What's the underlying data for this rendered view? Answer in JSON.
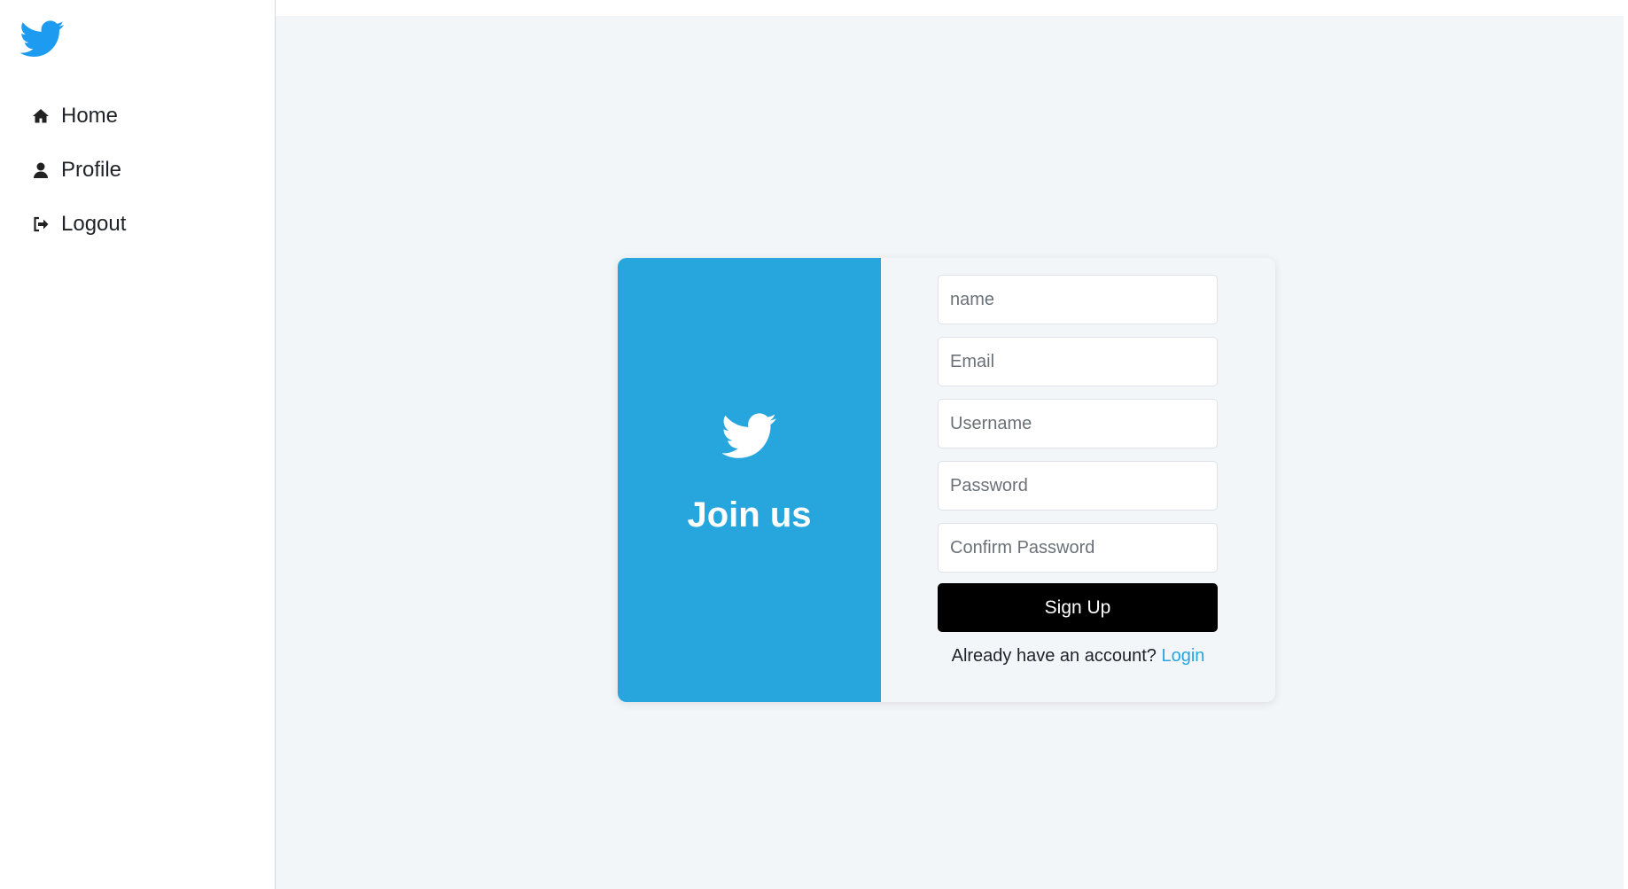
{
  "app": {
    "logo_icon": "twitter-bird-icon",
    "brand_color": "#27a6de"
  },
  "sidebar": {
    "items": [
      {
        "label": "Home",
        "icon": "home-icon"
      },
      {
        "label": "Profile",
        "icon": "user-icon"
      },
      {
        "label": "Logout",
        "icon": "logout-icon"
      }
    ]
  },
  "signup_card": {
    "panel_icon": "twitter-bird-icon",
    "heading": "Join us",
    "fields": {
      "name_placeholder": "name",
      "email_placeholder": "Email",
      "username_placeholder": "Username",
      "password_placeholder": "Password",
      "confirm_password_placeholder": "Confirm Password"
    },
    "submit_label": "Sign Up",
    "already_text": "Already have an account?",
    "login_label": "Login",
    "colors": {
      "panel": "#27a6de",
      "button": "#000000",
      "link": "#27a6de"
    }
  }
}
